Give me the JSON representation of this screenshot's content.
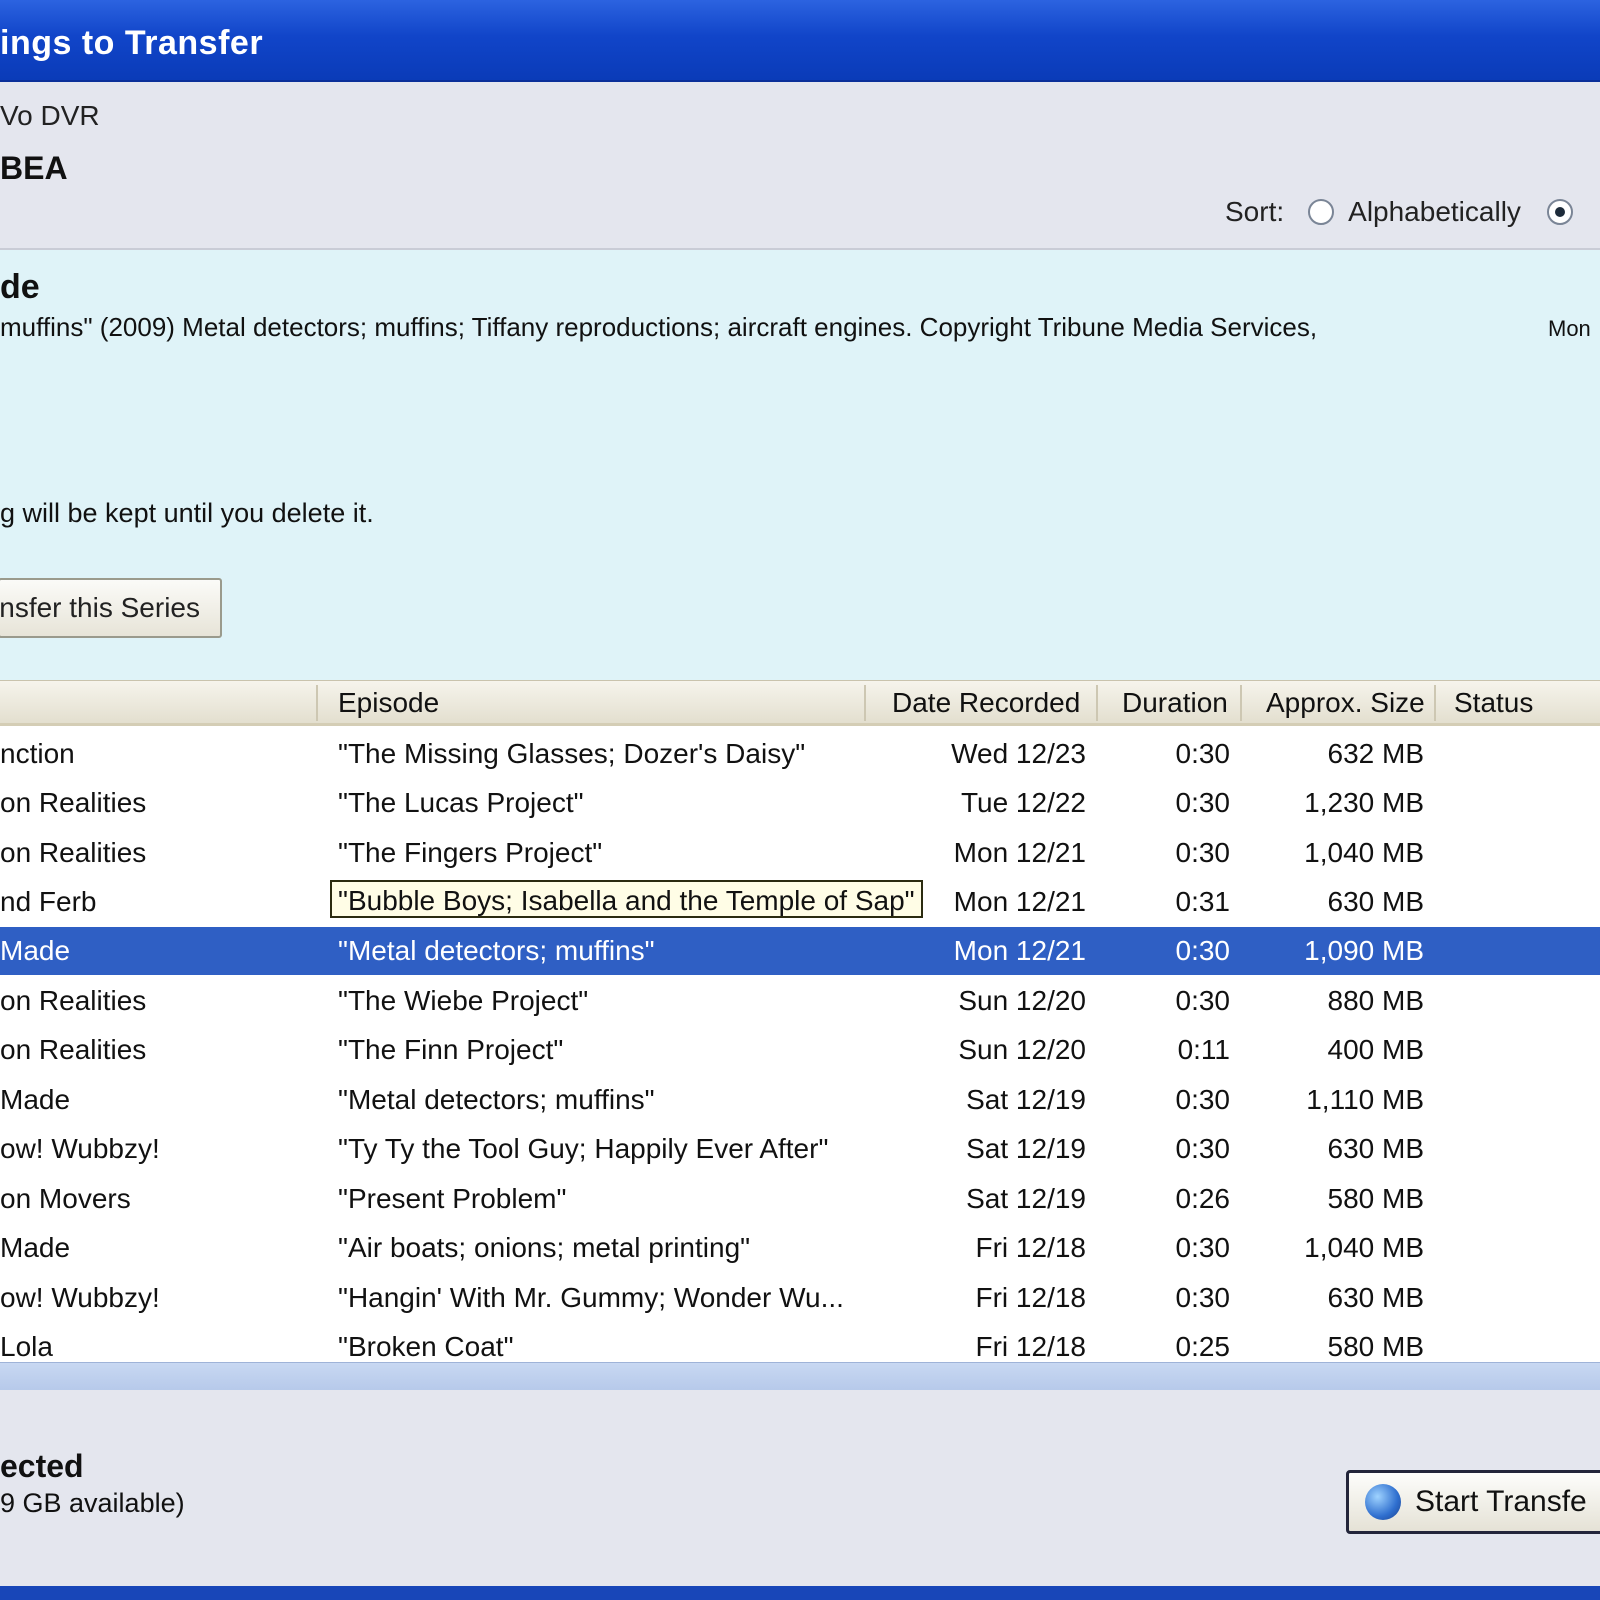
{
  "window": {
    "title": "ings to Transfer"
  },
  "header": {
    "device_label": "Vo DVR",
    "device_name": "BEA",
    "sort": {
      "label": "Sort:",
      "option_alpha": "Alphabetically",
      "selected": "second"
    }
  },
  "details": {
    "show_title": "de",
    "description": "muffins\" (2009) Metal detectors; muffins; Tiffany reproductions; aircraft engines. Copyright Tribune Media Services,",
    "right_date": "Mon",
    "keep_note": "g will be kept until you delete it.",
    "series_button": "ansfer this Series"
  },
  "list": {
    "columns": [
      "Episode",
      "Date Recorded",
      "Duration",
      "Approx. Size",
      "Status"
    ],
    "rows": [
      {
        "show": "nction",
        "episode": "\"The Missing Glasses; Dozer's Daisy\"",
        "date": "Wed 12/23",
        "duration": "0:30",
        "size": "632 MB"
      },
      {
        "show": "on Realities",
        "episode": "\"The Lucas Project\"",
        "date": "Tue 12/22",
        "duration": "0:30",
        "size": "1,230 MB"
      },
      {
        "show": "on Realities",
        "episode": "\"The Fingers Project\"",
        "date": "Mon 12/21",
        "duration": "0:30",
        "size": "1,040 MB"
      },
      {
        "show": "nd Ferb",
        "episode": "\"Bubble Boys; Isabella and the Temple of Sap\"",
        "date": "Mon 12/21",
        "duration": "0:31",
        "size": "630 MB"
      },
      {
        "show": "Made",
        "episode": "\"Metal detectors; muffins\"",
        "date": "Mon 12/21",
        "duration": "0:30",
        "size": "1,090 MB"
      },
      {
        "show": "on Realities",
        "episode": "\"The Wiebe Project\"",
        "date": "Sun 12/20",
        "duration": "0:30",
        "size": "880 MB"
      },
      {
        "show": "on Realities",
        "episode": "\"The Finn Project\"",
        "date": "Sun 12/20",
        "duration": "0:11",
        "size": "400 MB"
      },
      {
        "show": "Made",
        "episode": "\"Metal detectors; muffins\"",
        "date": "Sat 12/19",
        "duration": "0:30",
        "size": "1,110 MB"
      },
      {
        "show": "ow! Wubbzy!",
        "episode": "\"Ty Ty the Tool Guy; Happily Ever After\"",
        "date": "Sat 12/19",
        "duration": "0:30",
        "size": "630 MB"
      },
      {
        "show": "on Movers",
        "episode": "\"Present Problem\"",
        "date": "Sat 12/19",
        "duration": "0:26",
        "size": "580 MB"
      },
      {
        "show": "Made",
        "episode": "\"Air boats; onions; metal printing\"",
        "date": "Fri 12/18",
        "duration": "0:30",
        "size": "1,040 MB"
      },
      {
        "show": "ow! Wubbzy!",
        "episode": "\"Hangin' With Mr. Gummy; Wonder Wu...",
        "date": "Fri 12/18",
        "duration": "0:30",
        "size": "630 MB"
      },
      {
        "show": "Lola",
        "episode": "\"Broken Coat\"",
        "date": "Fri 12/18",
        "duration": "0:25",
        "size": "580 MB"
      }
    ]
  },
  "footer": {
    "selected_label": "ected",
    "space_label": "9 GB available)",
    "start_button": "Start Transfe"
  },
  "colors": {
    "title_bar": "#1145c9",
    "selection": "#2f5fc4",
    "details_bg": "#dff3f8"
  }
}
